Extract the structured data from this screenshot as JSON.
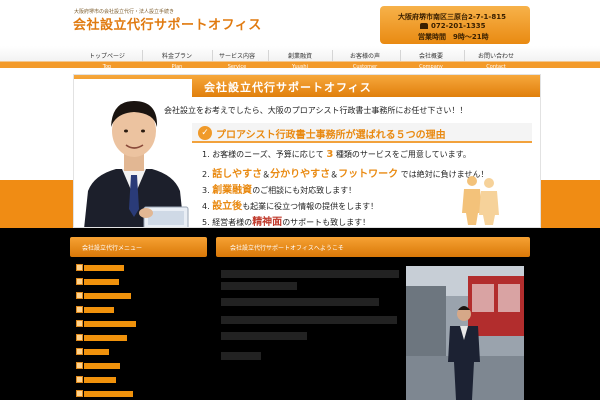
{
  "header": {
    "tagline": "大阪府堺市の会社設立代行・法人設立手続き",
    "site_title": "会社設立代行サポートオフィス",
    "address": "大阪府堺市南区三原台2-7-1-815",
    "tel": "072-201-1335",
    "hours": "営業時間　9時〜21時"
  },
  "nav": [
    {
      "jp": "トップページ",
      "en": "Top"
    },
    {
      "jp": "料金プラン",
      "en": "Plan"
    },
    {
      "jp": "サービス内容",
      "en": "Service"
    },
    {
      "jp": "創業融資",
      "en": "Yuushi"
    },
    {
      "jp": "お客様の声",
      "en": "Customer"
    },
    {
      "jp": "会社概要",
      "en": "Company"
    },
    {
      "jp": "お問い合わせ",
      "en": "Contact"
    }
  ],
  "banner": {
    "title": "会社設立代行サポートオフィス",
    "subtitle": "会社設立をお考えでしたら、大阪のプロアシスト行政書士事務所にお任せ下さい！！",
    "reason_title": "プロアシスト行政書士事務所が選ばれる５つの理由",
    "reasons": [
      {
        "num": "1.",
        "pre": "お客様のニーズ、予算に応じて",
        "hl": "3",
        "post": "種類のサービスをご用意しています。"
      },
      {
        "num": "2.",
        "pre": "",
        "hl": "話しやすさ",
        "mid": "＆",
        "hl_b": "分かりやすさ",
        "mid2": "＆",
        "hl_c": "フットワーク",
        "post": "では絶対に負けません！"
      },
      {
        "num": "3.",
        "pre": "",
        "hl": "創業融資",
        "post": "のご相談にも対応致します！"
      },
      {
        "num": "4.",
        "pre": "",
        "hl": "設立後",
        "post": "も起業に役立つ情報の提供をします！"
      },
      {
        "num": "5.",
        "pre": "経営者様の",
        "hl": "精神面",
        "post": "のサポートも致します！"
      }
    ]
  },
  "sidebar": {
    "heading": "会社設立代行メニュー",
    "items": [
      {
        "fill": 0.55
      },
      {
        "fill": 0.48
      },
      {
        "fill": 0.65
      },
      {
        "fill": 0.42
      },
      {
        "fill": 0.72
      },
      {
        "fill": 0.6
      },
      {
        "fill": 0.35
      },
      {
        "fill": 0.5
      },
      {
        "fill": 0.45
      },
      {
        "fill": 0.68
      }
    ]
  },
  "main": {
    "heading": "会社設立代行サポートオフィスへようこそ"
  },
  "colors": {
    "accent": "#f08c14",
    "accent_dark": "#d97808",
    "highlight_red": "#c0392b",
    "background_lower": "#000000"
  }
}
